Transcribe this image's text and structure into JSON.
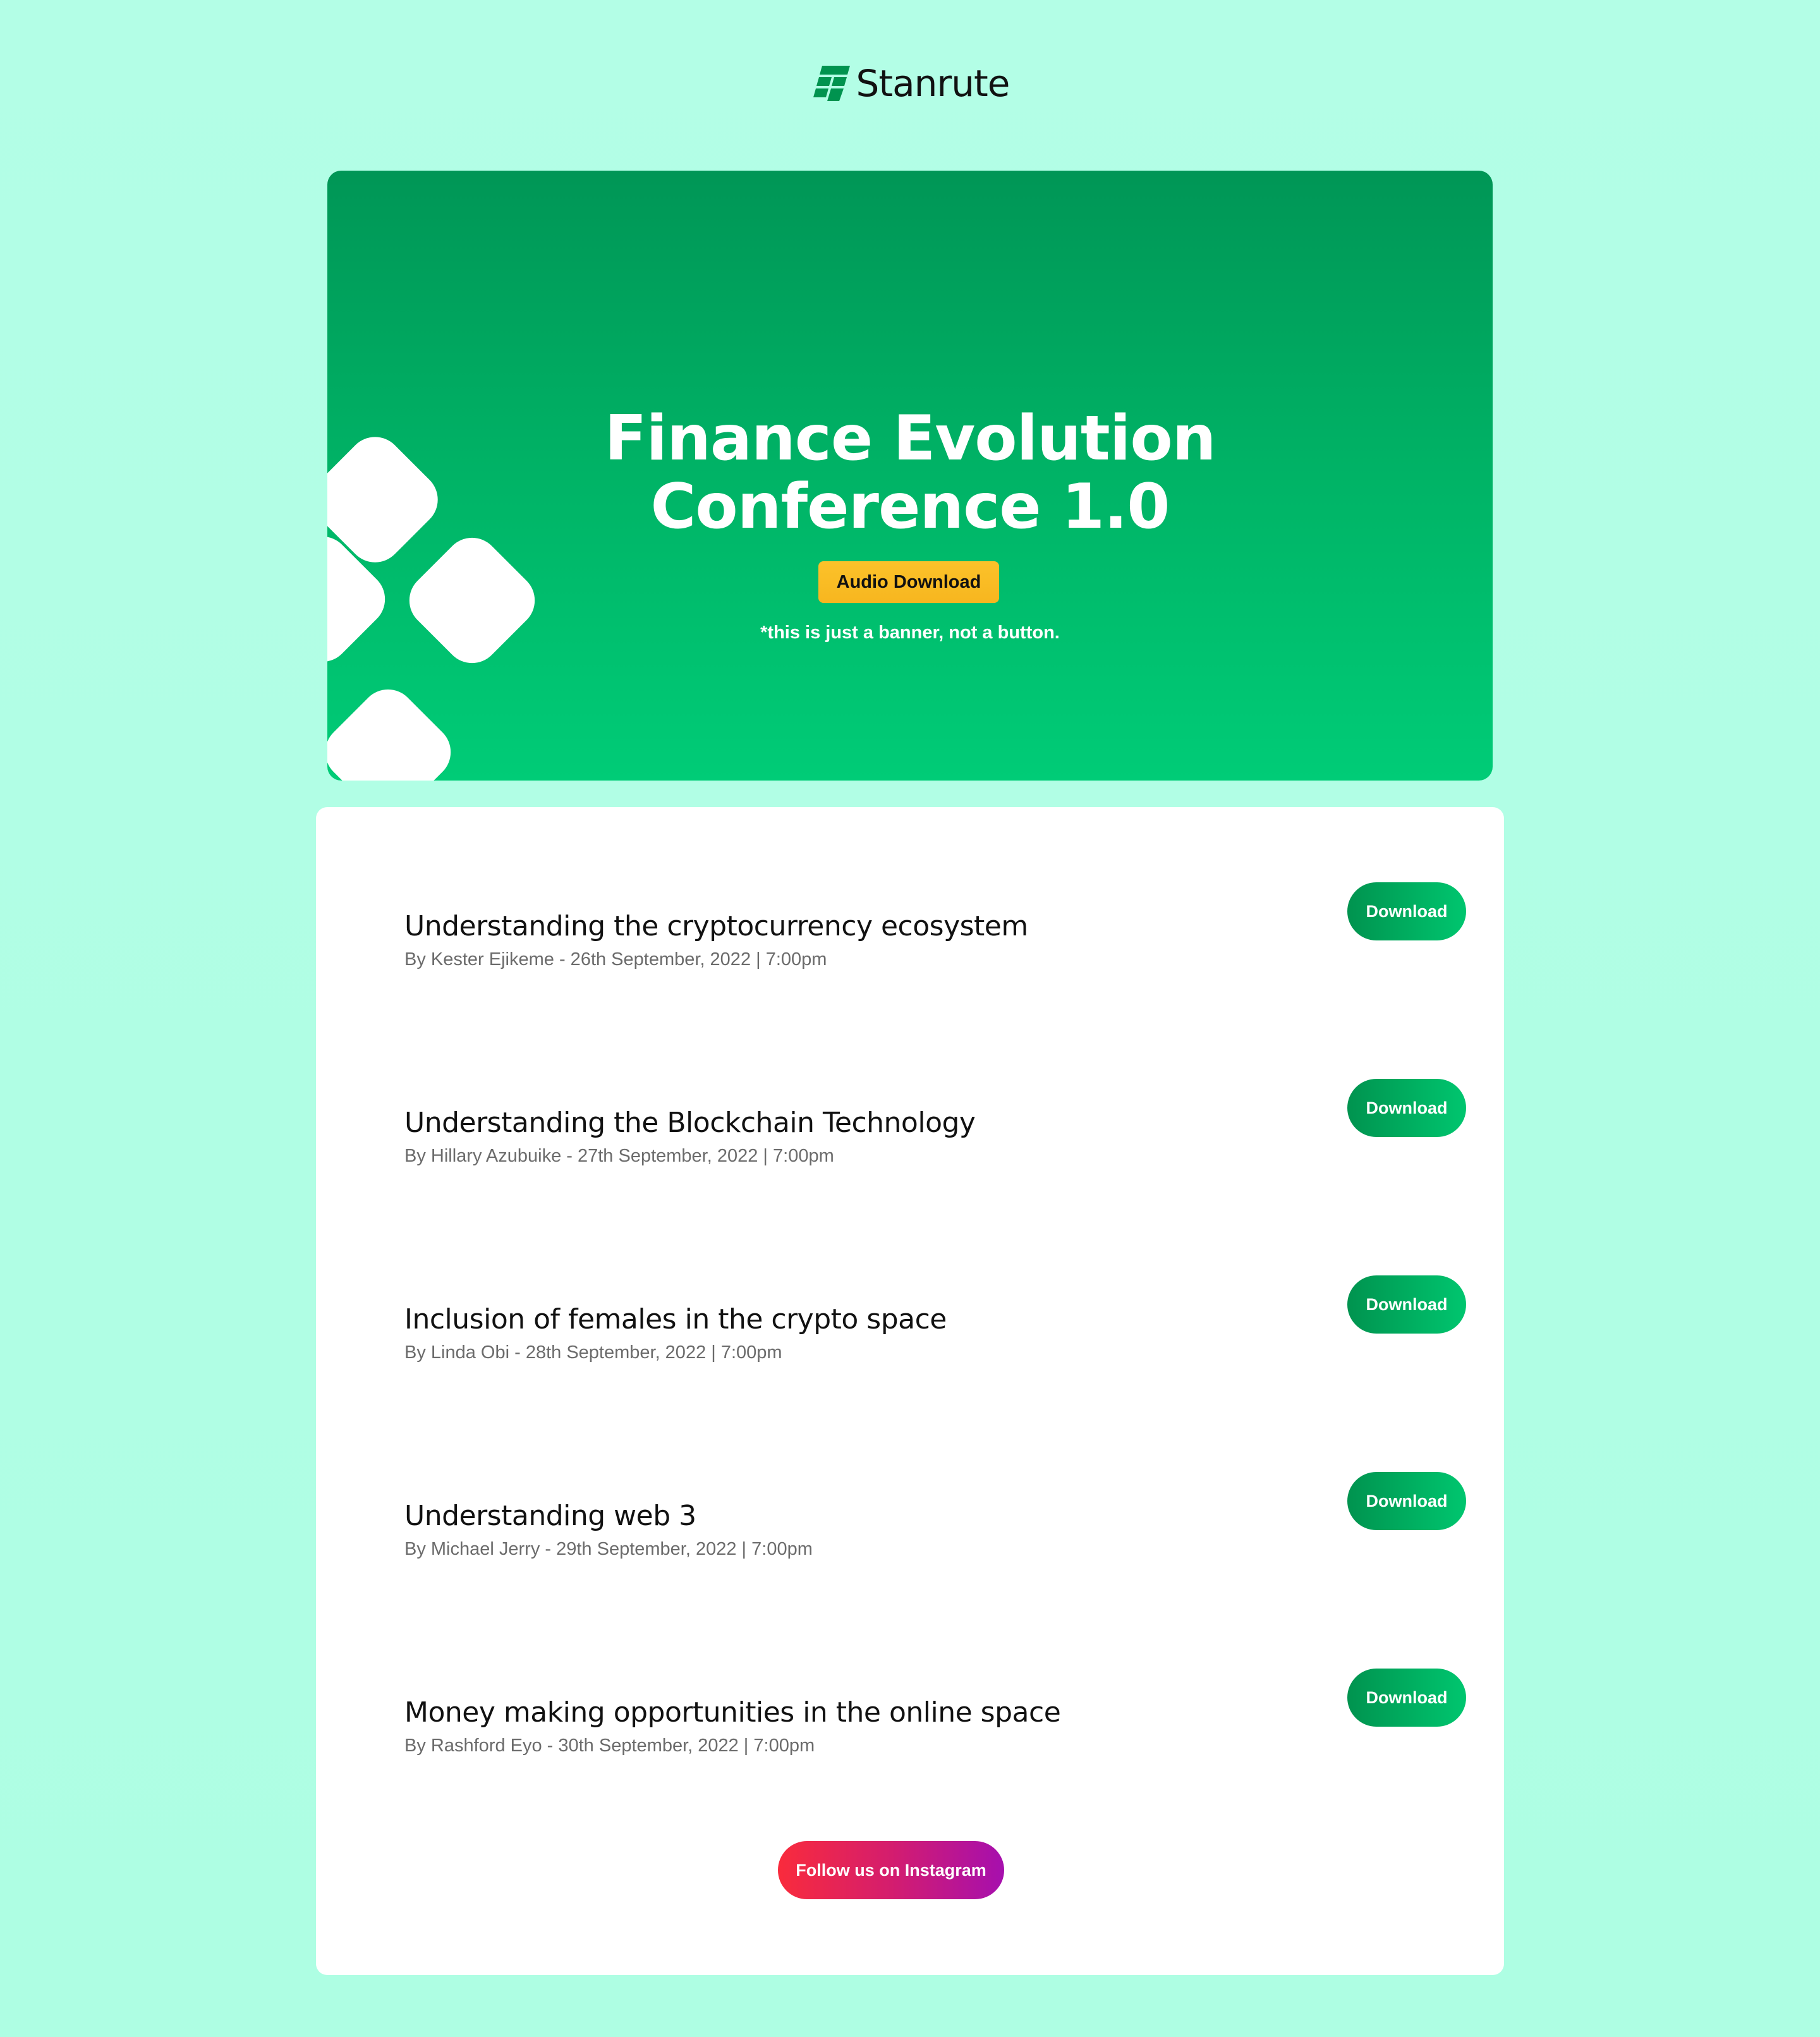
{
  "brand": {
    "name": "Stanrute",
    "color": "#00934f"
  },
  "banner": {
    "title_line1": "Finance Evolution",
    "title_line2": "Conference 1.0",
    "badge_label": "Audio Download",
    "note": "*this is just a banner, not a button."
  },
  "sessions": [
    {
      "title": "Understanding the cryptocurrency ecosystem",
      "meta": "By Kester Ejikeme - 26th September, 2022 | 7:00pm",
      "button_label": "Download"
    },
    {
      "title": "Understanding the Blockchain Technology",
      "meta": "By Hillary Azubuike - 27th September, 2022 | 7:00pm",
      "button_label": "Download"
    },
    {
      "title": "Inclusion of females in the crypto space",
      "meta": "By Linda Obi - 28th September, 2022 | 7:00pm",
      "button_label": "Download"
    },
    {
      "title": "Understanding web 3",
      "meta": "By Michael Jerry - 29th September, 2022 | 7:00pm",
      "button_label": "Download"
    },
    {
      "title": "Money making opportunities in the online space",
      "meta": "By Rashford Eyo - 30th September, 2022 | 7:00pm",
      "button_label": "Download"
    }
  ],
  "footer": {
    "instagram_label": "Follow us on Instagram"
  },
  "colors": {
    "page_background": "#b2fde6",
    "banner_green": "#00b366",
    "badge_yellow": "#fbc02d",
    "download_green": "#00a85c",
    "instagram_start": "#f92b3c",
    "instagram_end": "#a60fae"
  }
}
